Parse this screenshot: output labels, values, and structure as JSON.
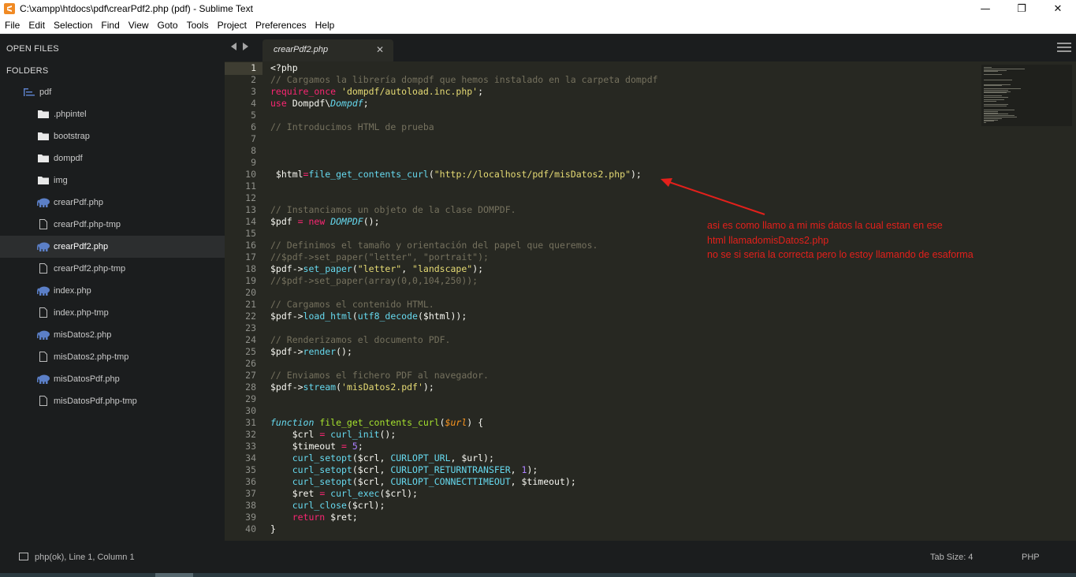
{
  "window": {
    "title": "C:\\xampp\\htdocs\\pdf\\crearPdf2.php (pdf) - Sublime Text",
    "controls": {
      "minimize": "—",
      "restore": "❐",
      "close": "✕"
    }
  },
  "menu": [
    "File",
    "Edit",
    "Selection",
    "Find",
    "View",
    "Goto",
    "Tools",
    "Project",
    "Preferences",
    "Help"
  ],
  "sidebar": {
    "open_files_label": "OPEN FILES",
    "folders_label": "FOLDERS",
    "root_folder": "pdf",
    "items": [
      {
        "label": ".phpintel",
        "type": "folder"
      },
      {
        "label": "bootstrap",
        "type": "folder"
      },
      {
        "label": "dompdf",
        "type": "folder"
      },
      {
        "label": "img",
        "type": "folder"
      },
      {
        "label": "crearPdf.php",
        "type": "php"
      },
      {
        "label": "crearPdf.php-tmp",
        "type": "file"
      },
      {
        "label": "crearPdf2.php",
        "type": "php",
        "active": true
      },
      {
        "label": "crearPdf2.php-tmp",
        "type": "file"
      },
      {
        "label": "index.php",
        "type": "php"
      },
      {
        "label": "index.php-tmp",
        "type": "file"
      },
      {
        "label": "misDatos2.php",
        "type": "php"
      },
      {
        "label": "misDatos2.php-tmp",
        "type": "file"
      },
      {
        "label": "misDatosPdf.php",
        "type": "php"
      },
      {
        "label": "misDatosPdf.php-tmp",
        "type": "file"
      }
    ]
  },
  "tab": {
    "label": "crearPdf2.php",
    "close": "✕"
  },
  "editor": {
    "line_numbers": [
      "1",
      "2",
      "3",
      "4",
      "5",
      "6",
      "7",
      "8",
      "9",
      "10",
      "11",
      "12",
      "13",
      "14",
      "15",
      "16",
      "17",
      "18",
      "19",
      "20",
      "21",
      "22",
      "23",
      "24",
      "25",
      "26",
      "27",
      "28",
      "29",
      "30",
      "31",
      "32",
      "33",
      "34",
      "35",
      "36",
      "37",
      "38",
      "39",
      "40"
    ],
    "lines": {
      "l1": "<?php",
      "l2": "// Cargamos la librería dompdf que hemos instalado en la carpeta dompdf",
      "l3a": "require_once",
      "l3b": " 'dompdf/autoload.inc.php'",
      "l3c": ";",
      "l4a": "use",
      "l4b": " Dompdf\\",
      "l4c": "Dompdf",
      "l4d": ";",
      "l6": "// Introducimos HTML de prueba",
      "l10a": " $html",
      "l10b": "=",
      "l10c": "file_get_contents_curl",
      "l10d": "(",
      "l10e": "\"http://localhost/pdf/misDatos2.php\"",
      "l10f": ");",
      "l13": "// Instanciamos un objeto de la clase DOMPDF.",
      "l14a": "$pdf ",
      "l14b": "=",
      "l14c": " new ",
      "l14d": "DOMPDF",
      "l14e": "();",
      "l16": "// Definimos el tamaño y orientación del papel que queremos.",
      "l17": "//$pdf->set_paper(\"letter\", \"portrait\");",
      "l18a": "$pdf->",
      "l18b": "set_paper",
      "l18c": "(",
      "l18d": "\"letter\"",
      "l18e": ", ",
      "l18f": "\"landscape\"",
      "l18g": ");",
      "l19": "//$pdf->set_paper(array(0,0,104,250));",
      "l21": "// Cargamos el contenido HTML.",
      "l22a": "$pdf->",
      "l22b": "load_html",
      "l22c": "(",
      "l22d": "utf8_decode",
      "l22e": "($html));",
      "l24": "// Renderizamos el documento PDF.",
      "l25a": "$pdf->",
      "l25b": "render",
      "l25c": "();",
      "l27": "// Enviamos el fichero PDF al navegador.",
      "l28a": "$pdf->",
      "l28b": "stream",
      "l28c": "(",
      "l28d": "'misDatos2.pdf'",
      "l28e": ");",
      "l31a": "function",
      "l31b": " file_get_contents_curl",
      "l31c": "(",
      "l31d": "$url",
      "l31e": ") {",
      "l32a": "    $crl ",
      "l32b": "=",
      "l32c": " curl_init",
      "l32d": "();",
      "l33a": "    $timeout ",
      "l33b": "=",
      "l33c": " 5",
      "l33d": ";",
      "l34a": "    curl_setopt",
      "l34b": "($crl, ",
      "l34c": "CURLOPT_URL",
      "l34d": ", $url);",
      "l35a": "    curl_setopt",
      "l35b": "($crl, ",
      "l35c": "CURLOPT_RETURNTRANSFER",
      "l35d": ", ",
      "l35e": "1",
      "l35f": ");",
      "l36a": "    curl_setopt",
      "l36b": "($crl, ",
      "l36c": "CURLOPT_CONNECTTIMEOUT",
      "l36d": ", $timeout);",
      "l37a": "    $ret ",
      "l37b": "=",
      "l37c": " curl_exec",
      "l37d": "($crl);",
      "l38a": "    curl_close",
      "l38b": "($crl);",
      "l39a": "    return",
      "l39b": " $ret;",
      "l40": "}"
    }
  },
  "annotation": {
    "line1": "asi es como llamo a mi mis datos la cual estan en ese",
    "line2": "html llamadomisDatos2.php",
    "line3": "no se si seria la correcta pero lo estoy llamando de esaforma"
  },
  "status": {
    "left": "php(ok), Line 1, Column 1",
    "tab_size": "Tab Size: 4",
    "syntax": "PHP"
  },
  "colors": {
    "editor_bg": "#272822",
    "sidebar_bg": "#1b1d1e",
    "annotation": "#e3201b",
    "php_icon": "#5b7fc7"
  }
}
